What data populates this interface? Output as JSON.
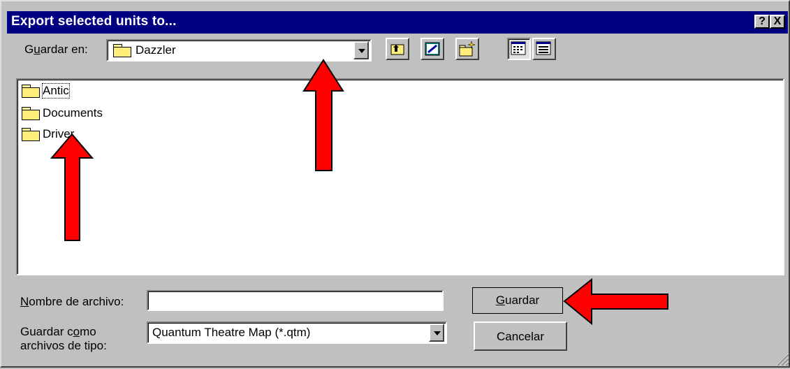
{
  "window": {
    "title": "Export selected units to...",
    "help_label": "?",
    "close_label": "X"
  },
  "location": {
    "label_prefix": "G",
    "label_underlined": "u",
    "label_suffix": "ardar en:",
    "current_folder": "Dazzler",
    "folder_icon": "folder-icon"
  },
  "toolbar": {
    "icons": [
      "up-one-level-icon",
      "desktop-icon",
      "new-folder-icon",
      "list-view-icon",
      "details-view-icon"
    ]
  },
  "files": [
    {
      "name": "Antic",
      "icon": "folder-icon",
      "focused": true
    },
    {
      "name": "Documents",
      "icon": "folder-icon",
      "focused": false
    },
    {
      "name": "Driver",
      "icon": "folder-icon",
      "focused": false
    }
  ],
  "filename": {
    "label_underlined": "N",
    "label_suffix": "ombre de archivo:",
    "value": ""
  },
  "filetype": {
    "label_line1_prefix": "Guardar c",
    "label_line1_underlined": "o",
    "label_line1_suffix": "mo",
    "label_line2": "archivos de tipo:",
    "selected": "Quantum Theatre Map (*.qtm)"
  },
  "buttons": {
    "save_underlined": "G",
    "save_suffix": "uardar",
    "cancel_label": "Cancelar"
  },
  "colors": {
    "titlebar": "#000080",
    "dialog_bg": "#c0c0c0",
    "arrow": "#ff0000"
  }
}
